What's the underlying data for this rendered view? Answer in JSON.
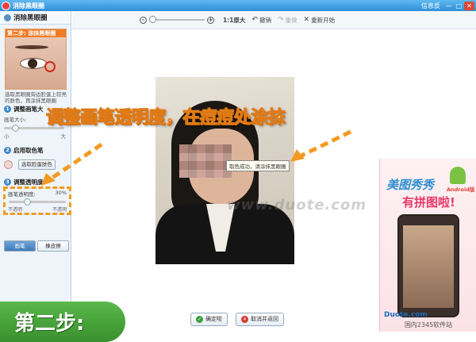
{
  "window": {
    "title": "消除黑眼圈",
    "feedback_link": "信息反",
    "min_btn": "—",
    "max_btn": "□",
    "close_btn": "✕"
  },
  "left_panel": {
    "title": "消除黑眼圈",
    "step_card_label": "第二步: 涂抹黑眼圈",
    "description": "选取黑眼圈旁边脸蛋上较亮的肤色，再涂抹黑眼圈",
    "section1": {
      "number": "1",
      "heading": "调整画笔大",
      "brush_size_label": "画笔大小:",
      "min_label": "小",
      "max_label": "大"
    },
    "section2": {
      "number": "2",
      "heading": "启用取色笔",
      "pick_button": "选取脸蛋肤色"
    },
    "section3": {
      "number": "3",
      "heading": "调整透明度"
    },
    "opacity": {
      "label": "画笔透明度:",
      "value": "30%",
      "value_fraction": 0.3,
      "min_label": "不透明",
      "max_label": "不透明"
    },
    "modes": [
      "画笔",
      "橡皮擦"
    ]
  },
  "toolbar": {
    "zoom_in": "+",
    "zoom_out": "-",
    "original_size": "1:1原大",
    "undo": "撤销",
    "redo": "重做",
    "restart": "重新开始"
  },
  "canvas": {
    "tooltip": "取色成功，请涂抹黑眼圈",
    "watermark": "www.duote.com"
  },
  "bottom": {
    "confirm": "确定啦",
    "cancel": "取消并返回"
  },
  "ad": {
    "brand": "美图秀秀",
    "android_label": "Android版",
    "tagline": "有拼图啦!",
    "domain": "Duote.com",
    "cn_domain": "国内2345软件站"
  },
  "overlay": {
    "caption": "调整画笔透明度，在痘痘处涂抹",
    "step_banner": "第二步:"
  },
  "colors": {
    "accent_orange": "#f49a22",
    "banner_green": "#4aa83c",
    "titlebar_blue": "#2d8fd8"
  }
}
